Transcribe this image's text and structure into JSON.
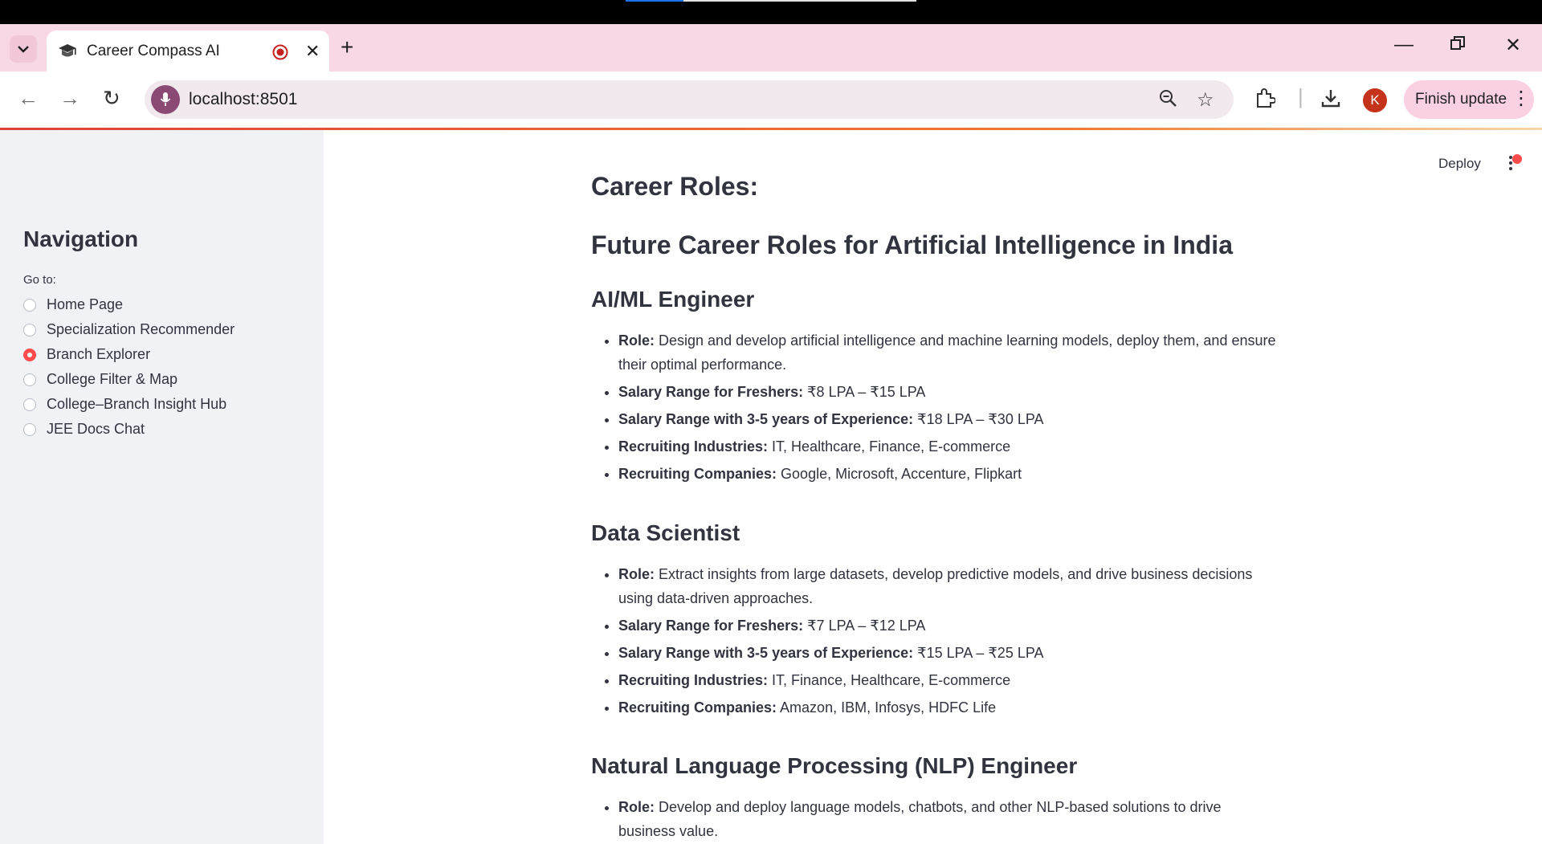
{
  "browser": {
    "tab_title": "Career Compass AI",
    "url": "localhost:8501",
    "profile_initial": "K",
    "finish_update_label": "Finish update"
  },
  "toolbar": {
    "deploy_label": "Deploy"
  },
  "sidebar": {
    "title": "Navigation",
    "goto_label": "Go to:",
    "options": [
      {
        "label": "Home Page",
        "selected": false
      },
      {
        "label": "Specialization Recommender",
        "selected": false
      },
      {
        "label": "Branch Explorer",
        "selected": true
      },
      {
        "label": "College Filter & Map",
        "selected": false
      },
      {
        "label": "College–Branch Insight Hub",
        "selected": false
      },
      {
        "label": "JEE Docs Chat",
        "selected": false
      }
    ]
  },
  "main": {
    "cut_heading": "Career Roles:",
    "heading": "Future Career Roles for Artificial Intelligence in India",
    "sections": [
      {
        "title": "AI/ML Engineer",
        "items": [
          {
            "label": "Role:",
            "text": "Design and develop artificial intelligence and machine learning models, deploy them, and ensure their optimal performance."
          },
          {
            "label": "Salary Range for Freshers:",
            "text": "₹8 LPA – ₹15 LPA"
          },
          {
            "label": "Salary Range with 3-5 years of Experience:",
            "text": "₹18 LPA – ₹30 LPA"
          },
          {
            "label": "Recruiting Industries:",
            "text": "IT, Healthcare, Finance, E-commerce"
          },
          {
            "label": "Recruiting Companies:",
            "text": "Google, Microsoft, Accenture, Flipkart"
          }
        ]
      },
      {
        "title": "Data Scientist",
        "items": [
          {
            "label": "Role:",
            "text": "Extract insights from large datasets, develop predictive models, and drive business decisions using data-driven approaches."
          },
          {
            "label": "Salary Range for Freshers:",
            "text": "₹7 LPA – ₹12 LPA"
          },
          {
            "label": "Salary Range with 3-5 years of Experience:",
            "text": "₹15 LPA – ₹25 LPA"
          },
          {
            "label": "Recruiting Industries:",
            "text": "IT, Finance, Healthcare, E-commerce"
          },
          {
            "label": "Recruiting Companies:",
            "text": "Amazon, IBM, Infosys, HDFC Life"
          }
        ]
      },
      {
        "title": "Natural Language Processing (NLP) Engineer",
        "items": [
          {
            "label": "Role:",
            "text": "Develop and deploy language models, chatbots, and other NLP-based solutions to drive business value."
          }
        ]
      }
    ]
  },
  "colors": {
    "accent": "#ff4b4b",
    "sidebar_bg": "#f0f2f6",
    "tabstrip_bg": "#f9d8e6",
    "text": "#31333f"
  }
}
